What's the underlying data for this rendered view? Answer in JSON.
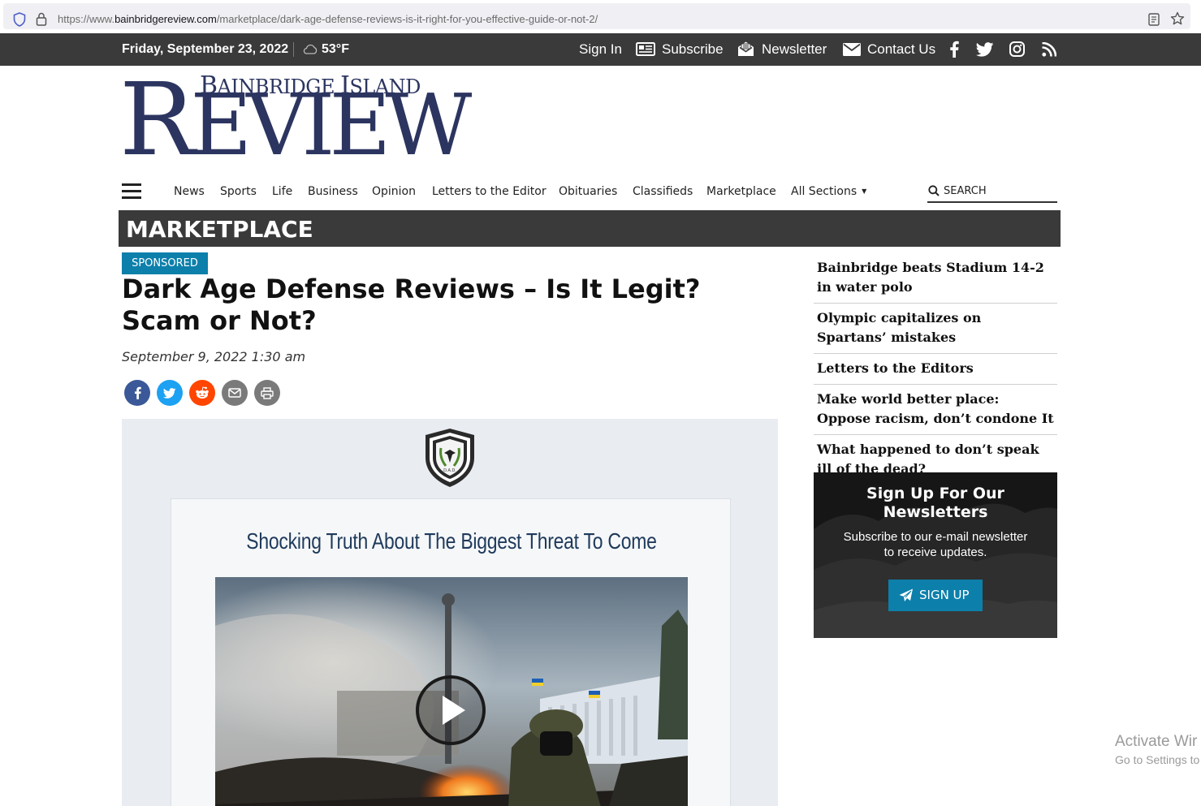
{
  "browser": {
    "url_prefix": "https://www.",
    "url_domain": "bainbridgereview.com",
    "url_path": "/marketplace/dark-age-defense-reviews-is-it-right-for-you-effective-guide-or-not-2/"
  },
  "topbar": {
    "date": "Friday, September 23, 2022",
    "temperature": "53°F",
    "sign_in": "Sign In",
    "subscribe": "Subscribe",
    "newsletter": "Newsletter",
    "contact": "Contact Us",
    "icons": [
      "facebook-icon",
      "twitter-icon",
      "instagram-icon",
      "rss-icon"
    ]
  },
  "logo": {
    "top_line_b": "B",
    "top_line_rest1": "AINBRIDGE ",
    "top_line_i": "I",
    "top_line_rest2": "SLAND",
    "big_r": "R",
    "big_rest": "EVIEW"
  },
  "nav": {
    "items": [
      "News",
      "Sports",
      "Life",
      "Business",
      "Opinion",
      "Letters to the Editor",
      "Obituaries",
      "Classifieds",
      "Marketplace",
      "All Sections"
    ],
    "search_label": "SEARCH"
  },
  "section": {
    "title": "MARKETPLACE"
  },
  "article": {
    "badge": "SPONSORED",
    "headline": "Dark Age Defense Reviews – Is It Legit? Scam or Not?",
    "date": "September 9, 2022 1:30 am",
    "share_icons": [
      "facebook-icon",
      "twitter-icon",
      "reddit-icon",
      "email-icon",
      "print-icon"
    ],
    "card_title": "Shocking Truth About The Biggest Threat To Come",
    "badge_text": "D.A.D."
  },
  "sidebar": {
    "items": [
      "Bainbridge beats Stadium 14-2 in water polo",
      "Olympic capitalizes on Spartans’ mistakes",
      "Letters to the Editors",
      "Make world better place: Oppose racism, don’t condone It",
      "What happened to don’t speak ill of the dead?"
    ]
  },
  "newsletter": {
    "title_line1": "Sign Up For Our",
    "title_line2": "Newsletters",
    "text_line1": "Subscribe to our e-mail newsletter",
    "text_line2": "to receive updates.",
    "button": "SIGN UP"
  },
  "watermark": {
    "line1": "Activate Wir",
    "line2": "Go to Settings to"
  },
  "colors": {
    "accent": "#0d7fab",
    "logo": "#2c3560",
    "topbar": "#3a3a3a"
  }
}
